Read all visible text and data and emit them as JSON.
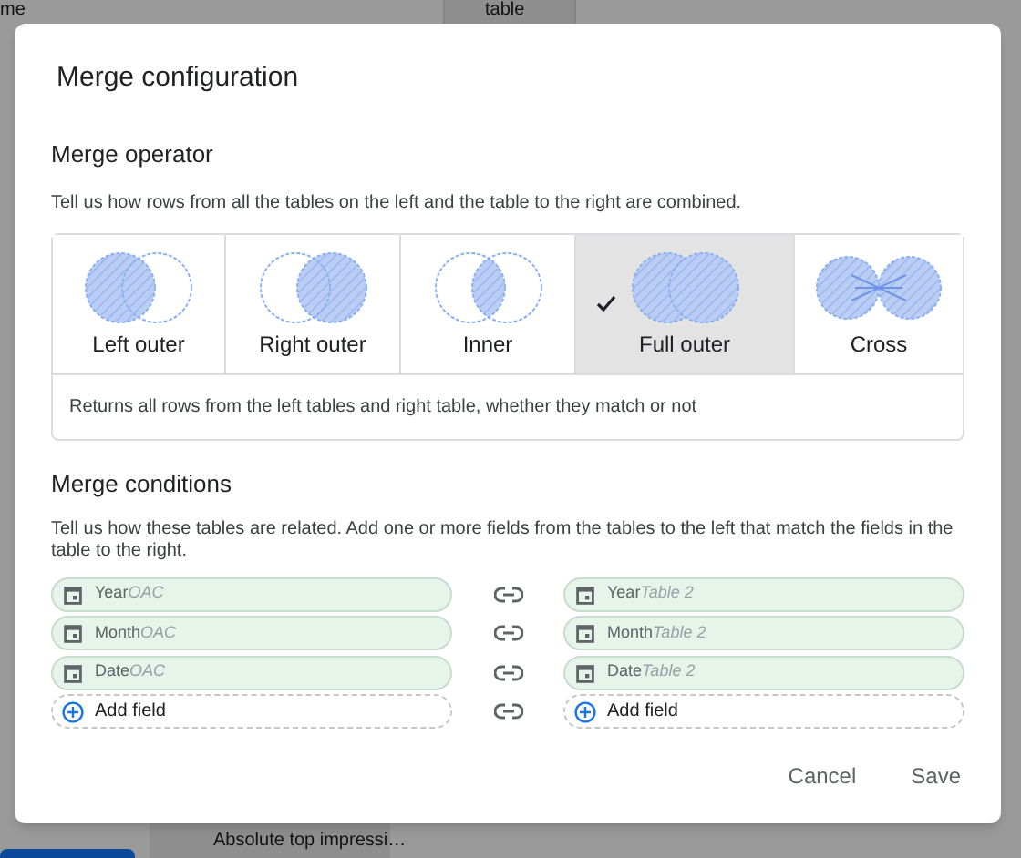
{
  "background": {
    "texts": [
      {
        "text": "me"
      },
      {
        "text": "table"
      },
      {
        "text": "Absolute top impressi…"
      }
    ]
  },
  "dialog": {
    "title": "Merge configuration",
    "operator": {
      "heading": "Merge operator",
      "description": "Tell us how rows from all the tables on the left and the table to the right are combined.",
      "options": [
        {
          "kind": "left",
          "label": "Left outer",
          "selected": false
        },
        {
          "kind": "right",
          "label": "Right outer",
          "selected": false
        },
        {
          "kind": "inner",
          "label": "Inner",
          "selected": false
        },
        {
          "kind": "full",
          "label": "Full outer",
          "selected": true
        },
        {
          "kind": "cross",
          "label": "Cross",
          "selected": false
        }
      ],
      "explanation": "Returns all rows from the left tables and right table, whether they match or not"
    },
    "conditions": {
      "heading": "Merge conditions",
      "description": "Tell us how these tables are related. Add one or more fields from the tables to the left that match the fields in the table to the right.",
      "rows": [
        {
          "kind": "field",
          "left": {
            "name": "Year",
            "source": "OAC"
          },
          "right": {
            "name": "Year",
            "source": "Table 2"
          }
        },
        {
          "kind": "field",
          "left": {
            "name": "Month",
            "source": "OAC"
          },
          "right": {
            "name": "Month",
            "source": "Table 2"
          }
        },
        {
          "kind": "field",
          "left": {
            "name": "Date",
            "source": "OAC"
          },
          "right": {
            "name": "Date",
            "source": "Table 2"
          }
        },
        {
          "kind": "add",
          "left": {
            "label": "Add field"
          },
          "right": {
            "label": "Add field"
          }
        }
      ]
    },
    "buttons": [
      "Cancel",
      "Save"
    ]
  }
}
